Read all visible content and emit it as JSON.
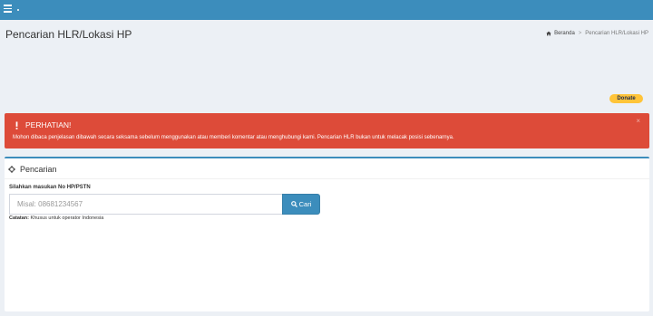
{
  "header": {
    "menu_icon": "hamburger-icon",
    "accent_color": "#3c8dbc"
  },
  "page": {
    "title": "Pencarian HLR/Lokasi HP"
  },
  "breadcrumb": {
    "home_icon": "home-icon",
    "home_label": "Beranda",
    "current_label": "Pencarian HLR/Lokasi HP"
  },
  "donate": {
    "label": "Donate",
    "color": "#ffc439"
  },
  "alert": {
    "icon": "exclamation-icon",
    "title": "PERHATIAN!",
    "text": "Mohon dibaca penjelasan dibawah secara seksama sebelum menggunakan atau memberi komentar atau menghubungi kami. Pencarian HLR bukan untuk melacak posisi sebenarnya.",
    "close_label": "×",
    "color": "#dd4b39"
  },
  "search_box": {
    "header_icon": "crosshair-icon",
    "header_title": "Pencarian",
    "field_label": "Silahkan masukan No HP/PSTN",
    "input_value": "",
    "input_placeholder": "Misal: 08681234567",
    "button_icon": "search-icon",
    "button_label": "Cari",
    "note_bold": "Catatan:",
    "note_text": " Khusus untuk operator Indonesia"
  }
}
